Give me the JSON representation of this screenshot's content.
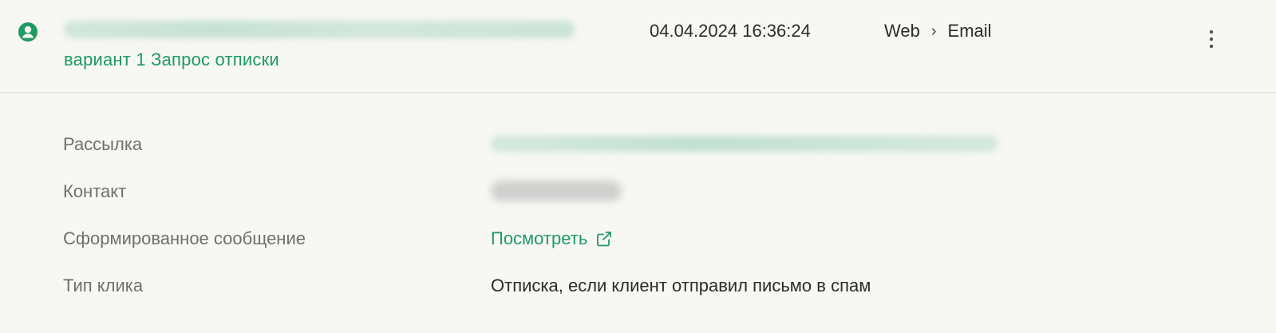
{
  "event": {
    "variant_text": "вариант 1 Запрос отписки",
    "datetime": "04.04.2024 16:36:24",
    "channel": {
      "from": "Web",
      "separator": "›",
      "to": "Email"
    }
  },
  "details": {
    "rows": [
      {
        "label": "Рассылка"
      },
      {
        "label": "Контакт"
      },
      {
        "label": "Сформированное сообщение",
        "link_text": "Посмотреть"
      },
      {
        "label": "Тип клика",
        "value": "Отписка, если клиент отправил письмо в спам"
      }
    ]
  },
  "colors": {
    "accent": "#1f9a64",
    "label": "#6f6f6f",
    "text": "#2b2b2b",
    "background": "#f7f7f4"
  },
  "icons": {
    "user": "user-circle-icon",
    "more": "more-vertical-icon",
    "external": "external-link-icon"
  }
}
